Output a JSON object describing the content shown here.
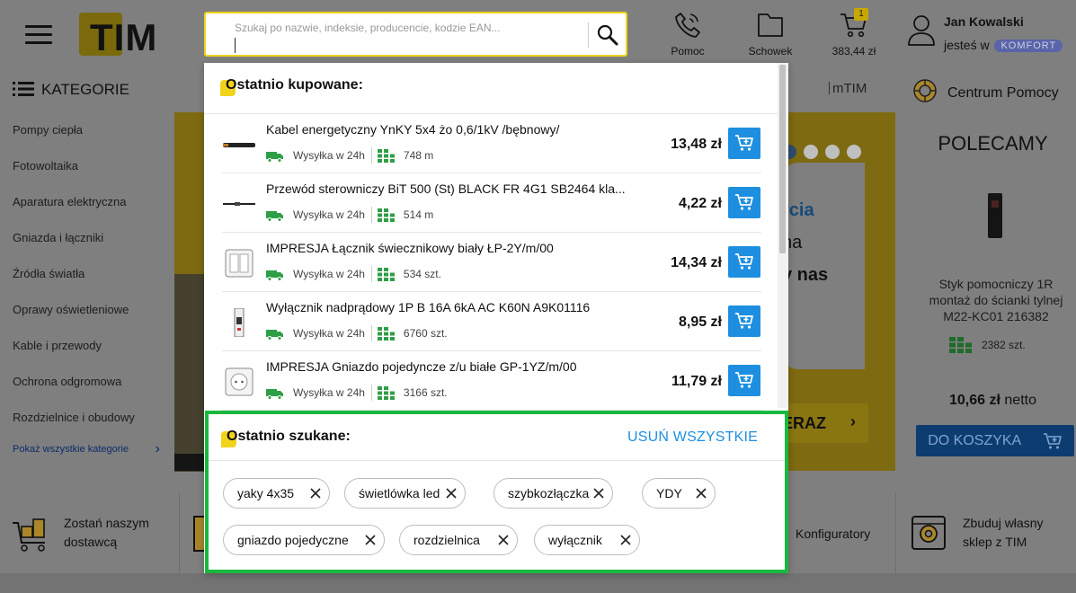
{
  "header": {
    "logo_text": "TIM",
    "search": {
      "placeholder": "Szukaj po nazwie, indeksie, producencie, kodzie EAN...",
      "value": ""
    },
    "help_label": "Pomoc",
    "saved_label": "Schowek",
    "cart": {
      "badge": "1",
      "total": "383,44 zł"
    },
    "user": {
      "name": "Jan Kowalski",
      "status_prefix": "jesteś w",
      "tier": "KOMFORT"
    }
  },
  "nav": {
    "categories_label": "KATEGORIE",
    "mtim_label": "mTIM",
    "help_center_label": "Centrum Pomocy"
  },
  "sidebar": {
    "items": [
      "Pompy ciepła",
      "Fotowoltaika",
      "Aparatura elektryczna",
      "Gniazda i łączniki",
      "Źródła światła",
      "Oprawy oświetleniowe",
      "Kable i przewody",
      "Ochrona odgromowa",
      "Rozdzielnice i obudowy"
    ],
    "show_all": "Pokaż wszystkie kategorie"
  },
  "banner": {
    "text1": "rcia",
    "text2": "na",
    "text3": "y nas",
    "cta": "ERAZ"
  },
  "recommended": {
    "title": "POLECAMY",
    "product_name": "Styk pomocniczy 1R montaż do ścianki tylnej M22-KC01 216382",
    "stock": "2382 szt.",
    "price": "10,66 zł",
    "price_suffix": "netto",
    "button": "DO KOSZYKA"
  },
  "bottom": {
    "supplier": "Zostań naszym dostawcą",
    "configurators": "Konfiguratory",
    "shop": "Zbuduj własny sklep z TIM"
  },
  "dropdown": {
    "recent_purchases_title": "Ostatnio kupowane:",
    "products": [
      {
        "name": "Kabel energetyczny YnKY 5x4 żo 0,6/1kV /bębnowy/",
        "shipping": "Wysyłka w 24h",
        "stock": "748 m",
        "price": "13,48 zł",
        "img": "cable"
      },
      {
        "name": "Przewód sterowniczy BiT 500 (St) BLACK FR 4G1 SB2464 kla...",
        "shipping": "Wysyłka w 24h",
        "stock": "514 m",
        "price": "4,22 zł",
        "img": "wire"
      },
      {
        "name": "IMPRESJA Łącznik świecznikowy biały ŁP-2Y/m/00",
        "shipping": "Wysyłka w 24h",
        "stock": "534 szt.",
        "price": "14,34 zł",
        "img": "switch"
      },
      {
        "name": "Wyłącznik nadprądowy 1P B 16A 6kA AC K60N A9K01116",
        "shipping": "Wysyłka w 24h",
        "stock": "6760 szt.",
        "price": "8,95 zł",
        "img": "breaker"
      },
      {
        "name": "IMPRESJA Gniazdo pojedyncze z/u białe GP-1YZ/m/00",
        "shipping": "Wysyłka w 24h",
        "stock": "3166 szt.",
        "price": "11,79 zł",
        "img": "socket"
      }
    ],
    "recent_searches_title": "Ostatnio szukane:",
    "clear_all": "USUŃ WSZYSTKIE",
    "recent_searches": [
      "yaky 4x35",
      "świetlówka led",
      "szybkozłączka",
      "YDY",
      "gniazdo pojedyczne",
      "rozdzielnica",
      "wyłącznik"
    ]
  }
}
